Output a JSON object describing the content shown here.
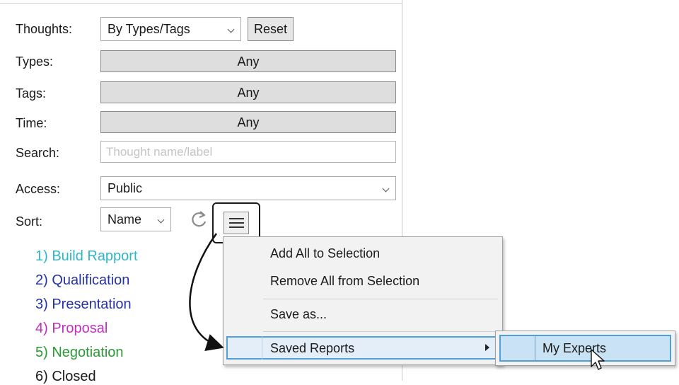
{
  "filters": {
    "thoughts_label": "Thoughts:",
    "thoughts_value": "By Types/Tags",
    "reset_label": "Reset",
    "types_label": "Types:",
    "types_value": "Any",
    "tags_label": "Tags:",
    "tags_value": "Any",
    "time_label": "Time:",
    "time_value": "Any",
    "search_label": "Search:",
    "search_placeholder": "Thought name/label",
    "access_label": "Access:",
    "access_value": "Public",
    "sort_label": "Sort:",
    "sort_value": "Name"
  },
  "icons": {
    "refresh": "refresh-icon",
    "menu": "hamburger-menu-icon",
    "chevron": "chevron-down-icon",
    "submenu_arrow": "chevron-right-icon",
    "cursor": "pointer-cursor-icon"
  },
  "stages": [
    {
      "label": "1) Build Rapport",
      "color": "#2fb8c4"
    },
    {
      "label": "2) Qualification",
      "color": "#2633a6"
    },
    {
      "label": "3) Presentation",
      "color": "#2633a6"
    },
    {
      "label": "4) Proposal",
      "color": "#c02fc0"
    },
    {
      "label": "5) Negotiation",
      "color": "#2a9a34"
    },
    {
      "label": "6) Closed",
      "color": "#1a1a1a"
    }
  ],
  "context_menu": {
    "add_all": "Add All to Selection",
    "remove_all": "Remove All from Selection",
    "save_as": "Save as...",
    "saved_reports": "Saved Reports"
  },
  "submenu": {
    "my_experts": "My Experts"
  },
  "colors": {
    "highlight_border": "#4ea0d6",
    "submenu_highlight": "#c9e3f5"
  }
}
